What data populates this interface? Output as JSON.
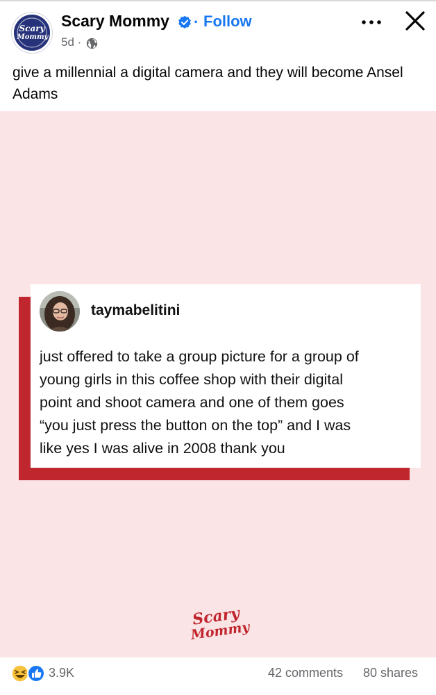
{
  "header": {
    "page_name": "Scary Mommy",
    "separator": "·",
    "follow_label": "Follow",
    "time": "5d ·",
    "avatar_logo_text": "Scary Mommy"
  },
  "post": {
    "caption": "give a millennial a digital camera and they will become Ansel Adams",
    "image": {
      "username": "taymabelitini",
      "text_lines": [
        "just offered to take a group picture for a group of",
        "young girls in this coffee shop with their digital",
        "point and shoot camera and one of them goes",
        "“you just press the button on the top” and I was",
        "like yes I was alive in 2008 thank you"
      ],
      "brand_logo_text": "Scary Mommy"
    }
  },
  "footer": {
    "reaction_count": "3.9K",
    "comments_label": "42 comments",
    "shares_label": "80 shares"
  },
  "icons": {
    "verified": "verified-badge-icon",
    "globe": "globe-icon",
    "more": "more-options-icon",
    "close": "close-icon",
    "reactions": [
      "haha-reaction-icon",
      "like-reaction-icon"
    ]
  },
  "colors": {
    "accent_blue": "#1877f2",
    "image_background": "#fbe4e5",
    "brand_red": "#c0262d",
    "secondary_text": "#65676b",
    "avatar_navy": "#26337a"
  }
}
